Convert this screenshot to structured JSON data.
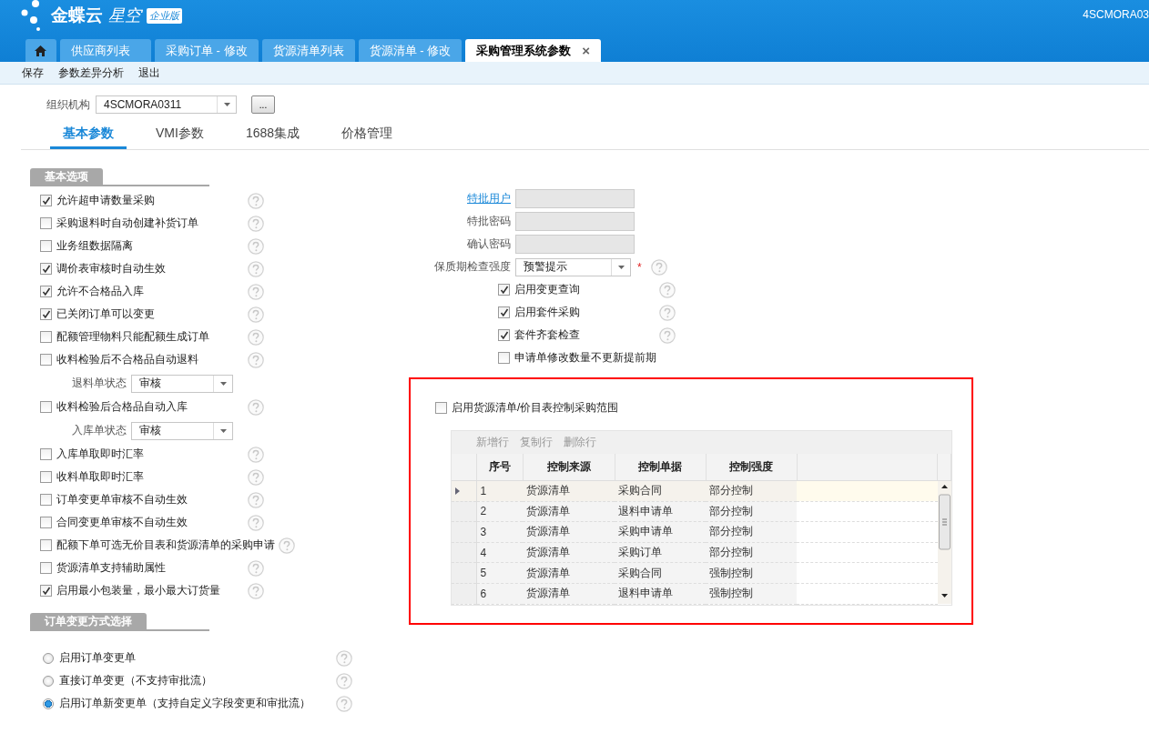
{
  "header": {
    "logo_main": "金蝶云",
    "logo_sub": "星空",
    "logo_badge": "企业版",
    "account": "4SCMORA03"
  },
  "tabs": [
    {
      "kind": "home",
      "selected": false
    },
    {
      "label": "供应商列表",
      "selected": false
    },
    {
      "label": "采购订单 - 修改",
      "selected": false
    },
    {
      "label": "货源清单列表",
      "selected": false
    },
    {
      "label": "货源清单 - 修改",
      "selected": false
    },
    {
      "label": "采购管理系统参数",
      "selected": true,
      "close": "×"
    }
  ],
  "toolbar": [
    "保存",
    "参数差异分析",
    "退出"
  ],
  "org": {
    "label": "组织机构",
    "value": "4SCMORA0311",
    "button": "..."
  },
  "param_tabs": [
    {
      "label": "基本参数",
      "selected": true
    },
    {
      "label": "VMI参数",
      "selected": false
    },
    {
      "label": "1688集成",
      "selected": false
    },
    {
      "label": "价格管理",
      "selected": false
    }
  ],
  "basic_section": {
    "title": "基本选项",
    "items": [
      {
        "kind": "checkbox",
        "label": "允许超申请数量采购",
        "checked": true,
        "help": true
      },
      {
        "kind": "checkbox",
        "label": "采购退料时自动创建补货订单",
        "checked": false,
        "help": true
      },
      {
        "kind": "checkbox",
        "label": "业务组数据隔离",
        "checked": false,
        "help": true
      },
      {
        "kind": "checkbox",
        "label": "调价表审核时自动生效",
        "checked": true,
        "help": true
      },
      {
        "kind": "checkbox",
        "label": "允许不合格品入库",
        "checked": true,
        "help": true
      },
      {
        "kind": "checkbox",
        "label": "已关闭订单可以变更",
        "checked": true,
        "help": true
      },
      {
        "kind": "checkbox",
        "label": "配额管理物料只能配额生成订单",
        "checked": false,
        "help": true
      },
      {
        "kind": "checkbox",
        "label": "收料检验后不合格品自动退料",
        "checked": false,
        "help": true
      },
      {
        "kind": "select",
        "label": "退料单状态",
        "value": "审核"
      },
      {
        "kind": "checkbox",
        "label": "收料检验后合格品自动入库",
        "checked": false,
        "help": true
      },
      {
        "kind": "select",
        "label": "入库单状态",
        "value": "审核"
      },
      {
        "kind": "checkbox",
        "label": "入库单取即时汇率",
        "checked": false,
        "help": true
      },
      {
        "kind": "checkbox",
        "label": "收料单取即时汇率",
        "checked": false,
        "help": true
      },
      {
        "kind": "checkbox",
        "label": "订单变更单审核不自动生效",
        "checked": false,
        "help": true
      },
      {
        "kind": "checkbox",
        "label": "合同变更单审核不自动生效",
        "checked": false,
        "help": true
      },
      {
        "kind": "checkbox",
        "label": "配额下单可选无价目表和货源清单的采购申请",
        "checked": false,
        "help": true
      },
      {
        "kind": "checkbox",
        "label": "货源清单支持辅助属性",
        "checked": false,
        "help": true
      },
      {
        "kind": "checkbox",
        "label": "启用最小包装量，最小最大订货量",
        "checked": true,
        "help": true
      }
    ]
  },
  "change_section": {
    "title": "订单变更方式选择",
    "options": [
      {
        "label": "启用订单变更单",
        "selected": false,
        "help": true
      },
      {
        "label": "直接订单变更（不支持审批流）",
        "selected": false,
        "help": true
      },
      {
        "label": "启用订单新变更单（支持自定义字段变更和审批流）",
        "selected": true,
        "help": true
      }
    ]
  },
  "right_form": [
    {
      "kind": "link-field",
      "label": "特批用户"
    },
    {
      "kind": "field",
      "label": "特批密码"
    },
    {
      "kind": "field",
      "label": "确认密码"
    },
    {
      "kind": "select",
      "label": "保质期检查强度",
      "value": "预警提示",
      "required": true,
      "required_mark": "*",
      "help": true
    },
    {
      "kind": "checkbox",
      "label": "启用变更查询",
      "checked": true,
      "help": true
    },
    {
      "kind": "checkbox",
      "label": "启用套件采购",
      "checked": true,
      "help": true
    },
    {
      "kind": "checkbox",
      "label": "套件齐套检查",
      "checked": true,
      "help": true
    },
    {
      "kind": "checkbox",
      "label": "申请单修改数量不更新提前期",
      "checked": false,
      "help": false
    }
  ],
  "source_control": {
    "label": "启用货源清单/价目表控制采购范围",
    "checked": false,
    "grid_toolbar": [
      "新增行",
      "复制行",
      "删除行"
    ],
    "columns": [
      "序号",
      "控制来源",
      "控制单据",
      "控制强度"
    ],
    "rows": [
      {
        "cells": [
          "1",
          "货源清单",
          "采购合同",
          "部分控制"
        ],
        "selected": true
      },
      {
        "cells": [
          "2",
          "货源清单",
          "退料申请单",
          "部分控制"
        ],
        "selected": false
      },
      {
        "cells": [
          "3",
          "货源清单",
          "采购申请单",
          "部分控制"
        ],
        "selected": false
      },
      {
        "cells": [
          "4",
          "货源清单",
          "采购订单",
          "部分控制"
        ],
        "selected": false
      },
      {
        "cells": [
          "5",
          "货源清单",
          "采购合同",
          "强制控制"
        ],
        "selected": false
      },
      {
        "cells": [
          "6",
          "货源清单",
          "退料申请单",
          "强制控制"
        ],
        "selected": false
      }
    ]
  }
}
